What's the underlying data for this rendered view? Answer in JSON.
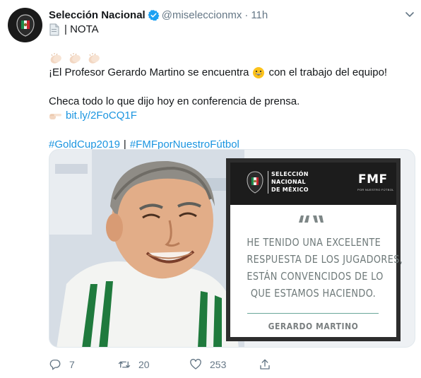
{
  "tweet": {
    "author_name": "Selección Nacional",
    "handle": "@miseleccionmx",
    "separator": "·",
    "time": "11h",
    "tag_line": "| NOTA",
    "text_main": "¡El Profesor Gerardo Martino se encuentra",
    "text_main_end": "con el trabajo del equipo!",
    "text_detail": "Checa todo lo que dijo hoy en conferencia de prensa.",
    "link": "bit.ly/2FoCQ1F",
    "hashtag_1": "#GoldCup2019",
    "hashtag_sep": "|",
    "hashtag_2": "#FMFporNuestroFútbol"
  },
  "media": {
    "federation_lines": [
      "SELECCIÓN",
      "NACIONAL",
      "DE MÉXICO"
    ],
    "brand": "FMF",
    "brand_sub": "POR NUESTRO FÚTBOL",
    "quote_lines": [
      "HE TENIDO UNA EXCELENTE",
      "RESPUESTA DE LOS JUGADORES,",
      "ESTÁN CONVENCIDOS DE LO",
      "QUE ESTAMOS HACIENDO."
    ],
    "quote_author": "GERARDO MARTINO"
  },
  "actions": {
    "reply_count": "7",
    "retweet_count": "20",
    "like_count": "253"
  },
  "icons": {
    "verified": "verified-badge-icon",
    "document": "page-facing-up-icon",
    "clap": "clapping-hands-icon",
    "smile": "grinning-face-icon",
    "pointer": "backhand-index-pointing-right-icon",
    "reply": "reply-icon",
    "retweet": "retweet-icon",
    "like": "heart-icon",
    "share": "share-icon",
    "more": "chevron-down-icon"
  },
  "colors": {
    "link": "#1b95e0",
    "verified": "#1da1f2",
    "secondary_text": "#657786"
  }
}
